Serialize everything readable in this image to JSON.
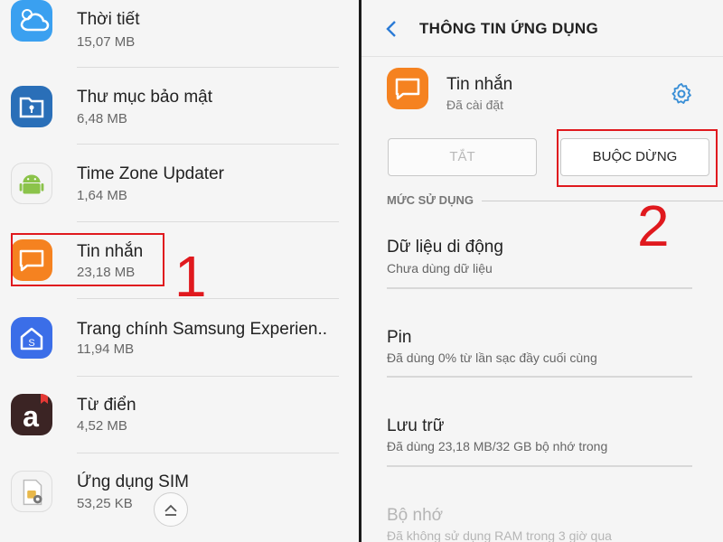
{
  "left": {
    "apps": [
      {
        "name": "Thời tiết",
        "size": "15,07 MB",
        "icon": "weather-icon"
      },
      {
        "name": "Thư mục bảo mật",
        "size": "6,48 MB",
        "icon": "secure-folder-icon"
      },
      {
        "name": "Time Zone Updater",
        "size": "1,64 MB",
        "icon": "android-icon"
      },
      {
        "name": "Tin nhắn",
        "size": "23,18 MB",
        "icon": "messages-icon"
      },
      {
        "name": "Trang chính Samsung Experien..",
        "size": "11,94 MB",
        "icon": "samsung-home-icon"
      },
      {
        "name": "Từ điển",
        "size": "4,52 MB",
        "icon": "dictionary-icon"
      },
      {
        "name": "Ứng dụng SIM",
        "size": "53,25 KB",
        "icon": "sim-toolkit-icon"
      }
    ],
    "step_label": "1",
    "scroll_top_icon": "chevron-up-icon"
  },
  "right": {
    "title": "THÔNG TIN ỨNG DỤNG",
    "app_name": "Tin nhắn",
    "app_status": "Đã cài đặt",
    "btn_disable": "TẮT",
    "btn_force_stop": "BUỘC DỪNG",
    "step_label": "2",
    "section_usage": "MỨC SỬ DỤNG",
    "items": [
      {
        "title": "Dữ liệu di động",
        "sub": "Chưa dùng dữ liệu"
      },
      {
        "title": "Pin",
        "sub": "Đã dùng 0% từ lần sạc đầy cuối cùng"
      },
      {
        "title": "Lưu trữ",
        "sub": "Đã dùng 23,18 MB/32 GB bộ nhớ trong"
      },
      {
        "title": "Bộ nhớ",
        "sub": "Đã không sử dụng RAM trong 3 giờ qua"
      }
    ]
  },
  "colors": {
    "accent_red": "#e0191e",
    "messages_orange": "#f58220",
    "settings_blue": "#3a8fd6"
  }
}
